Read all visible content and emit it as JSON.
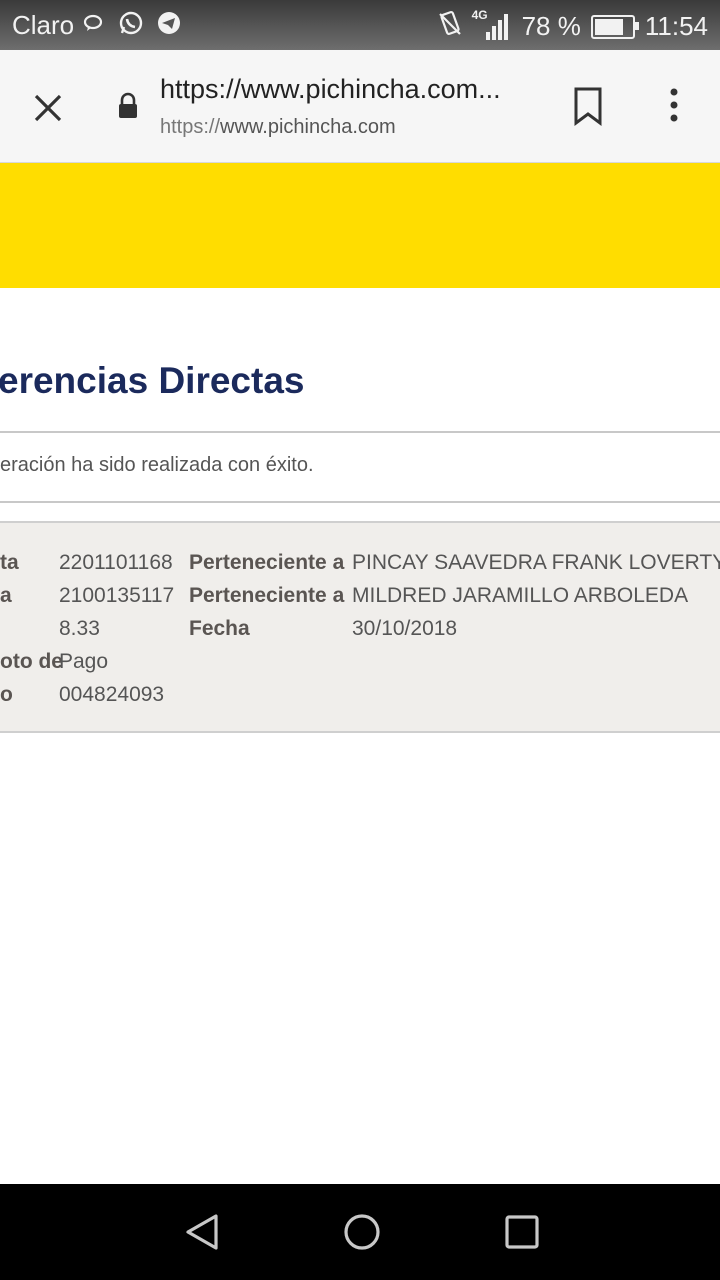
{
  "status_bar": {
    "carrier": "Claro",
    "network": "4G",
    "battery": "78 %",
    "battery_level": 0.78,
    "time": "11:54"
  },
  "browser": {
    "url_title": "https://www.pichincha.com...",
    "url_scheme": "https://",
    "url_host": "www.pichincha.com"
  },
  "page": {
    "title": "erencias Directas",
    "message": "eración ha sido realizada con éxito.",
    "details": {
      "left_labels": [
        "ta",
        "a",
        "",
        "oto de",
        "o"
      ],
      "left_values": [
        "2201101168",
        "2100135117",
        "8.33",
        "Pago",
        "004824093"
      ],
      "right_labels": [
        "Perteneciente a",
        "Perteneciente a",
        "Fecha"
      ],
      "right_values": [
        "PINCAY SAAVEDRA FRANK LOVERTY",
        "MILDRED JARAMILLO ARBOLEDA",
        "30/10/2018"
      ]
    }
  },
  "colors": {
    "banner": "#ffdd00",
    "title": "#1b2a5c"
  }
}
